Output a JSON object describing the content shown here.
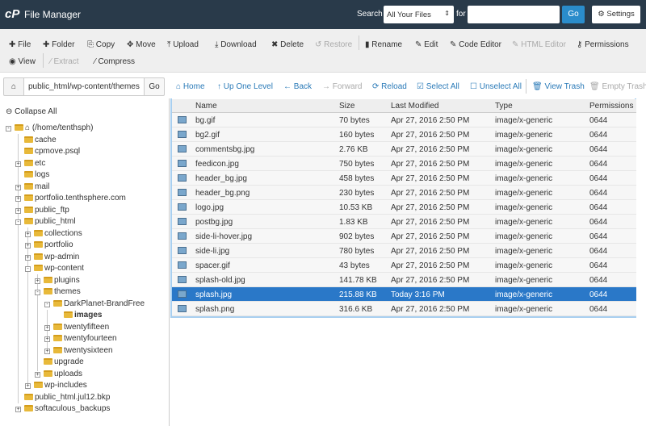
{
  "header": {
    "logo": "cP",
    "title": "File Manager",
    "search_label": "Search",
    "search_scope": "All Your Files",
    "for_label": "for",
    "search_value": "",
    "go": "Go",
    "settings": "Settings"
  },
  "toolbar": [
    {
      "label": "File",
      "icon": "plus",
      "enabled": true
    },
    {
      "label": "Folder",
      "icon": "plus",
      "enabled": true
    },
    {
      "label": "Copy",
      "icon": "copy",
      "enabled": true
    },
    {
      "label": "Move",
      "icon": "move",
      "enabled": true
    },
    {
      "label": "Upload",
      "icon": "upload",
      "enabled": true
    },
    {
      "label": "Download",
      "icon": "download",
      "enabled": true
    },
    {
      "label": "Delete",
      "icon": "x",
      "enabled": true
    },
    {
      "label": "Restore",
      "icon": "undo",
      "enabled": false
    },
    {
      "label": "Rename",
      "icon": "file",
      "enabled": true
    },
    {
      "label": "Edit",
      "icon": "pencil",
      "enabled": true
    },
    {
      "label": "Code Editor",
      "icon": "edit",
      "enabled": true
    },
    {
      "label": "HTML Editor",
      "icon": "edit",
      "enabled": false
    },
    {
      "label": "Permissions",
      "icon": "key",
      "enabled": true
    },
    {
      "label": "View",
      "icon": "eye",
      "enabled": true
    },
    {
      "label": "Extract",
      "icon": "wand",
      "enabled": false
    },
    {
      "label": "Compress",
      "icon": "wand",
      "enabled": true
    }
  ],
  "nav": {
    "path": "public_html/wp-content/themes",
    "go": "Go",
    "buttons": [
      {
        "label": "Home",
        "icon": "home",
        "enabled": true
      },
      {
        "label": "Up One Level",
        "icon": "up",
        "enabled": true
      },
      {
        "label": "Back",
        "icon": "arrow-left",
        "enabled": true
      },
      {
        "label": "Forward",
        "icon": "arrow-right",
        "enabled": false
      },
      {
        "label": "Reload",
        "icon": "refresh",
        "enabled": true
      },
      {
        "label": "Select All",
        "icon": "check-square",
        "enabled": true
      },
      {
        "label": "Unselect All",
        "icon": "square",
        "enabled": true
      },
      {
        "label": "View Trash",
        "icon": "trash",
        "enabled": true
      },
      {
        "label": "Empty Trash",
        "icon": "trash",
        "enabled": false
      }
    ]
  },
  "tree": {
    "collapse_all": "Collapse All",
    "items": [
      {
        "label": "(/home/tenthsph)",
        "level": 0,
        "toggle": "-",
        "home": true
      },
      {
        "label": "cache",
        "level": 1,
        "toggle": ""
      },
      {
        "label": "cpmove.psql",
        "level": 1,
        "toggle": ""
      },
      {
        "label": "etc",
        "level": 1,
        "toggle": "+"
      },
      {
        "label": "logs",
        "level": 1,
        "toggle": ""
      },
      {
        "label": "mail",
        "level": 1,
        "toggle": "+"
      },
      {
        "label": "portfolio.tenthsphere.com",
        "level": 1,
        "toggle": "+"
      },
      {
        "label": "public_ftp",
        "level": 1,
        "toggle": "+"
      },
      {
        "label": "public_html",
        "level": 1,
        "toggle": "-"
      },
      {
        "label": "collections",
        "level": 2,
        "toggle": "+"
      },
      {
        "label": "portfolio",
        "level": 2,
        "toggle": "+"
      },
      {
        "label": "wp-admin",
        "level": 2,
        "toggle": "+"
      },
      {
        "label": "wp-content",
        "level": 2,
        "toggle": "-"
      },
      {
        "label": "plugins",
        "level": 3,
        "toggle": "+"
      },
      {
        "label": "themes",
        "level": 3,
        "toggle": "-"
      },
      {
        "label": "DarkPlanet-BrandFree",
        "level": 4,
        "toggle": "-"
      },
      {
        "label": "images",
        "level": 5,
        "toggle": "",
        "bold": true
      },
      {
        "label": "twentyfifteen",
        "level": 4,
        "toggle": "+"
      },
      {
        "label": "twentyfourteen",
        "level": 4,
        "toggle": "+"
      },
      {
        "label": "twentysixteen",
        "level": 4,
        "toggle": "+"
      },
      {
        "label": "upgrade",
        "level": 3,
        "toggle": ""
      },
      {
        "label": "uploads",
        "level": 3,
        "toggle": "+"
      },
      {
        "label": "wp-includes",
        "level": 2,
        "toggle": "+"
      },
      {
        "label": "public_html.jul12.bkp",
        "level": 1,
        "toggle": ""
      },
      {
        "label": "softaculous_backups",
        "level": 1,
        "toggle": "+"
      }
    ]
  },
  "table": {
    "columns": [
      "Name",
      "Size",
      "Last Modified",
      "Type",
      "Permissions"
    ],
    "rows": [
      [
        "bg.gif",
        "70 bytes",
        "Apr 27, 2016 2:50 PM",
        "image/x-generic",
        "0644"
      ],
      [
        "bg2.gif",
        "160 bytes",
        "Apr 27, 2016 2:50 PM",
        "image/x-generic",
        "0644"
      ],
      [
        "commentsbg.jpg",
        "2.76 KB",
        "Apr 27, 2016 2:50 PM",
        "image/x-generic",
        "0644"
      ],
      [
        "feedicon.jpg",
        "750 bytes",
        "Apr 27, 2016 2:50 PM",
        "image/x-generic",
        "0644"
      ],
      [
        "header_bg.jpg",
        "458 bytes",
        "Apr 27, 2016 2:50 PM",
        "image/x-generic",
        "0644"
      ],
      [
        "header_bg.png",
        "230 bytes",
        "Apr 27, 2016 2:50 PM",
        "image/x-generic",
        "0644"
      ],
      [
        "logo.jpg",
        "10.53 KB",
        "Apr 27, 2016 2:50 PM",
        "image/x-generic",
        "0644"
      ],
      [
        "postbg.jpg",
        "1.83 KB",
        "Apr 27, 2016 2:50 PM",
        "image/x-generic",
        "0644"
      ],
      [
        "side-li-hover.jpg",
        "902 bytes",
        "Apr 27, 2016 2:50 PM",
        "image/x-generic",
        "0644"
      ],
      [
        "side-li.jpg",
        "780 bytes",
        "Apr 27, 2016 2:50 PM",
        "image/x-generic",
        "0644"
      ],
      [
        "spacer.gif",
        "43 bytes",
        "Apr 27, 2016 2:50 PM",
        "image/x-generic",
        "0644"
      ],
      [
        "splash-old.jpg",
        "141.78 KB",
        "Apr 27, 2016 2:50 PM",
        "image/x-generic",
        "0644"
      ],
      [
        "splash.jpg",
        "215.88 KB",
        "Today 3:16 PM",
        "image/x-generic",
        "0644"
      ],
      [
        "splash.png",
        "316.6 KB",
        "Apr 27, 2016 2:50 PM",
        "image/x-generic",
        "0644"
      ]
    ],
    "selected_index": 12
  },
  "colors": {
    "header_bg": "#293a4a",
    "accent": "#2a8ccb",
    "selection": "#2a78c8",
    "link": "#2a7ab8"
  }
}
